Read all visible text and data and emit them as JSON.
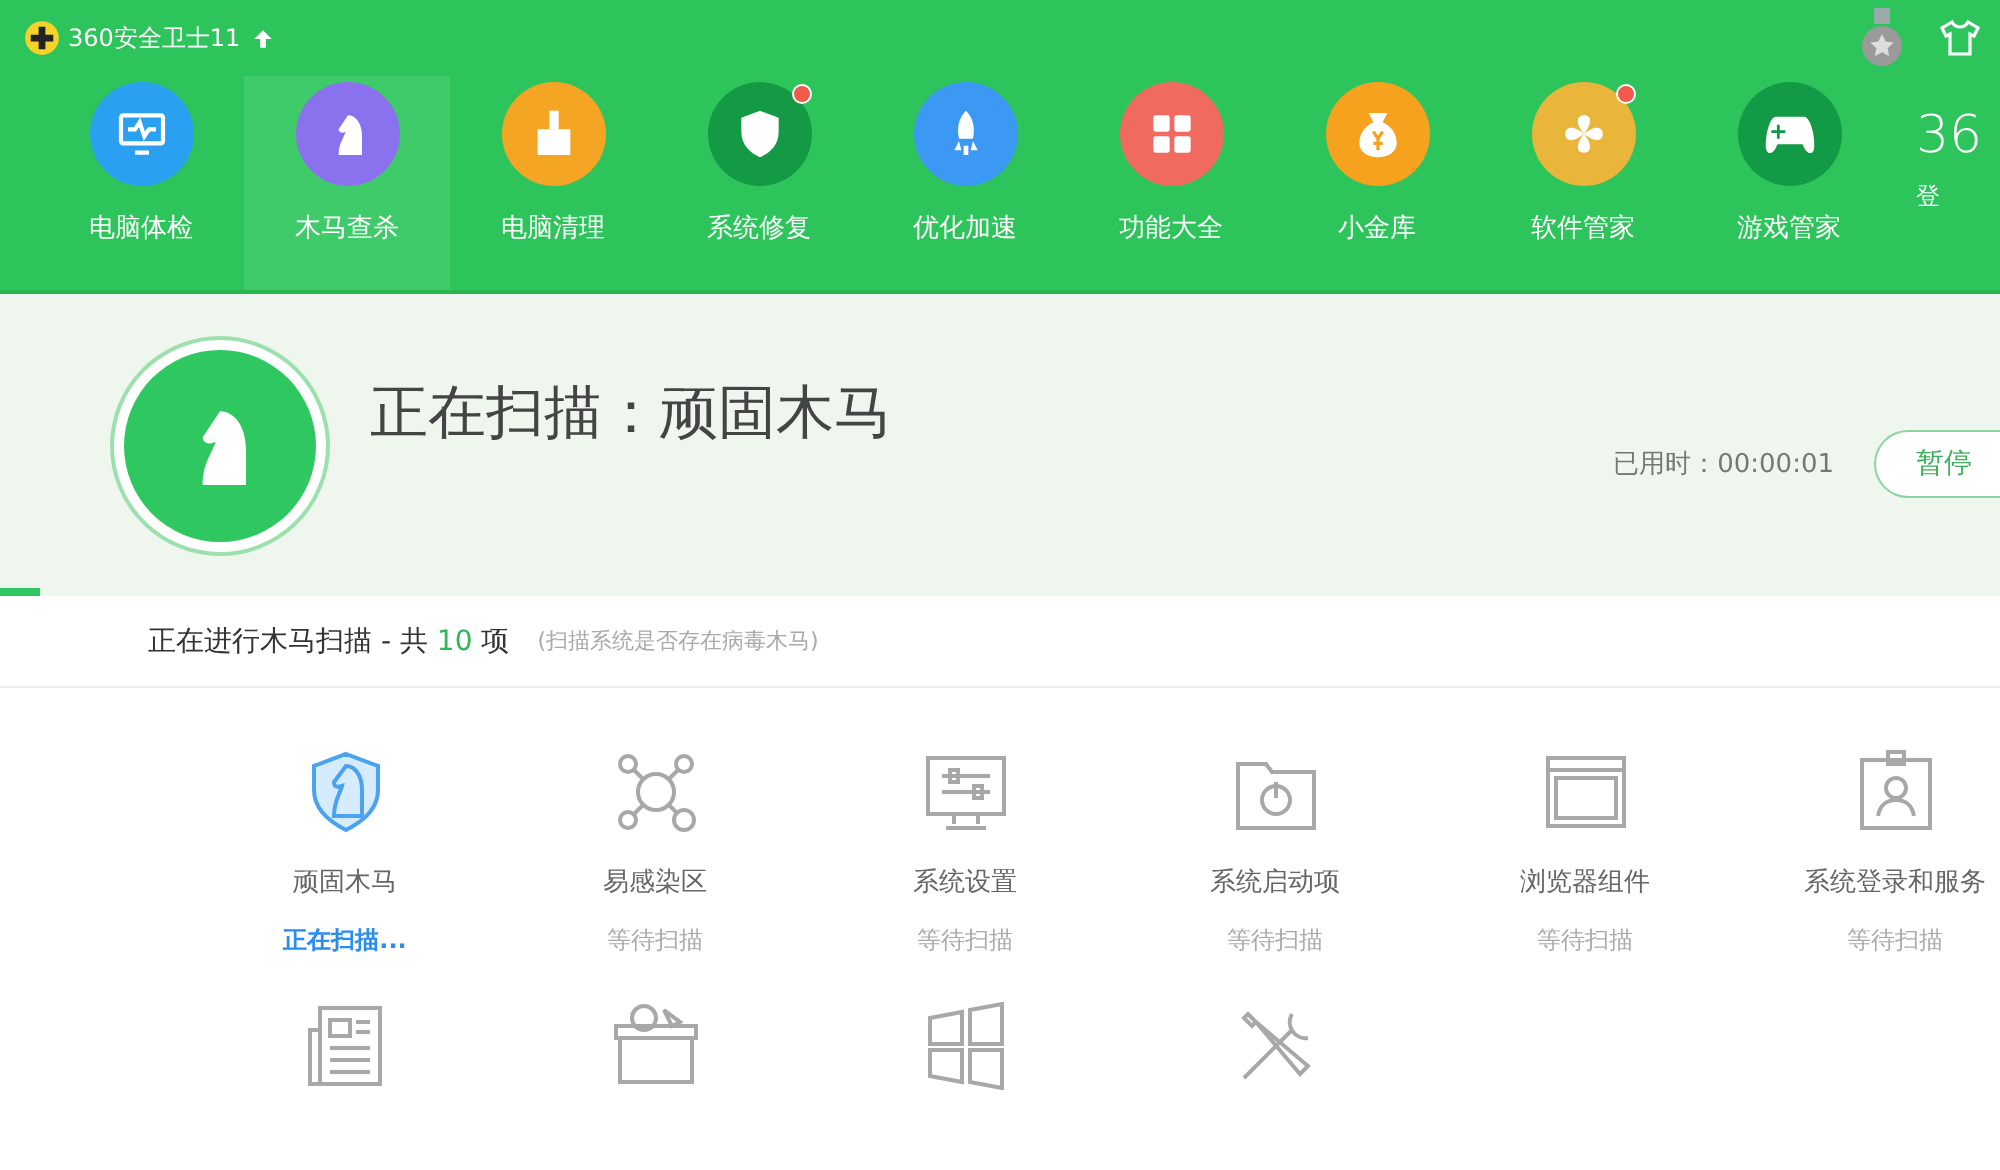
{
  "app": {
    "title": "360安全卫士11",
    "partial_logo": "36",
    "partial_login": "登"
  },
  "nav": [
    {
      "label": "电脑体检",
      "color": "#2b9ff0",
      "selected": false,
      "badge": false
    },
    {
      "label": "木马查杀",
      "color": "#8a72ee",
      "selected": true,
      "badge": false
    },
    {
      "label": "电脑清理",
      "color": "#f5a524",
      "selected": false,
      "badge": false
    },
    {
      "label": "系统修复",
      "color": "#149a45",
      "selected": false,
      "badge": true
    },
    {
      "label": "优化加速",
      "color": "#3b98f3",
      "selected": false,
      "badge": false
    },
    {
      "label": "功能大全",
      "color": "#f06a5f",
      "selected": false,
      "badge": false
    },
    {
      "label": "小金库",
      "color": "#f7a21f",
      "selected": false,
      "badge": false
    },
    {
      "label": "软件管家",
      "color": "#e9b53b",
      "selected": false,
      "badge": true
    },
    {
      "label": "游戏管家",
      "color": "#139a46",
      "selected": false,
      "badge": false
    }
  ],
  "scan": {
    "title": "正在扫描：顽固木马",
    "elapsed_label": "已用时：",
    "elapsed": "00:00:01",
    "pause_button": "暂停",
    "level": 0.02,
    "summary_prefix": "正在进行木马扫描 - 共",
    "count": "10",
    "summary_suffix": "项",
    "hint": "(扫描系统是否存在病毒木马)"
  },
  "items": [
    {
      "name": "顽固木马",
      "status": "正在扫描...",
      "kind": "scanning"
    },
    {
      "name": "易感染区",
      "status": "等待扫描",
      "kind": "waiting"
    },
    {
      "name": "系统设置",
      "status": "等待扫描",
      "kind": "waiting"
    },
    {
      "name": "系统启动项",
      "status": "等待扫描",
      "kind": "waiting"
    },
    {
      "name": "浏览器组件",
      "status": "等待扫描",
      "kind": "waiting"
    },
    {
      "name": "系统登录和服务",
      "status": "等待扫描",
      "kind": "waiting"
    },
    {
      "kind": "waiting"
    },
    {
      "kind": "waiting"
    },
    {
      "kind": "waiting"
    },
    {
      "kind": "waiting"
    }
  ]
}
